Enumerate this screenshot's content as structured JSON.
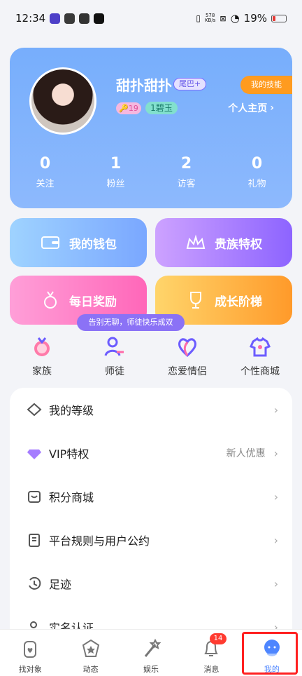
{
  "status_bar": {
    "time": "12:34",
    "network_speed_value": "578",
    "network_speed_unit": "KB/s",
    "battery_text": "19%"
  },
  "profile": {
    "nickname": "甜扑甜扑",
    "tail_badge": "尾巴+",
    "level": "19",
    "rank": "碧玉",
    "skill_tag": "我的技能",
    "homepage": "个人主页",
    "stats": [
      {
        "value": "0",
        "label": "关注"
      },
      {
        "value": "1",
        "label": "粉丝"
      },
      {
        "value": "2",
        "label": "访客"
      },
      {
        "value": "0",
        "label": "礼物"
      }
    ]
  },
  "shortcuts": {
    "wallet": "我的钱包",
    "noble": "贵族特权",
    "daily_reward": "每日奖励",
    "growth": "成长阶梯"
  },
  "mentor_tip": "告别无聊，师徒快乐成双",
  "quick_actions": [
    "家族",
    "师徒",
    "恋爱情侣",
    "个性商城"
  ],
  "menu": [
    {
      "label": "我的等级",
      "sub": ""
    },
    {
      "label": "VIP特权",
      "sub": "新人优惠"
    },
    {
      "label": "积分商城",
      "sub": ""
    },
    {
      "label": "平台规则与用户公约",
      "sub": ""
    },
    {
      "label": "足迹",
      "sub": ""
    },
    {
      "label": "实名认证",
      "sub": ""
    }
  ],
  "tabs": [
    {
      "label": "找对象"
    },
    {
      "label": "动态"
    },
    {
      "label": "娱乐"
    },
    {
      "label": "消息"
    },
    {
      "label": "我的"
    }
  ],
  "message_count": "14",
  "colors": {
    "accent": "#6d8cff",
    "badge_red": "#ff3b30",
    "selected_tab": "#4e86ff"
  }
}
